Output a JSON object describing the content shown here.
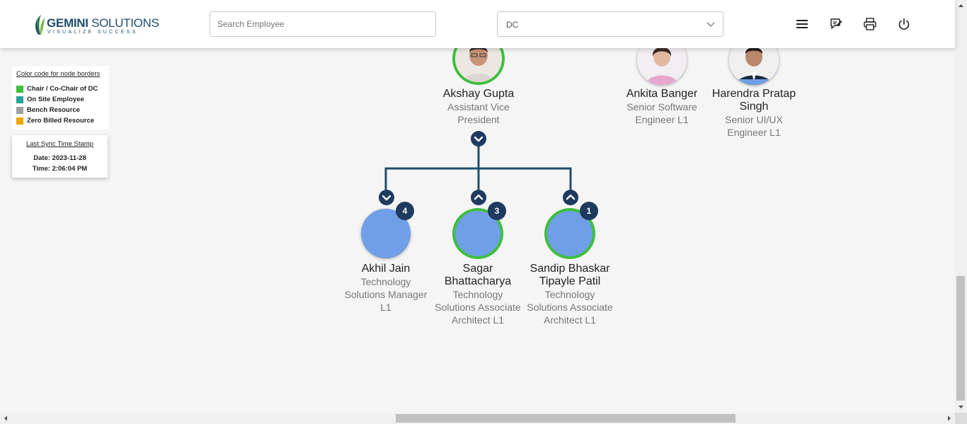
{
  "header": {
    "logo_main_bold": "GEMINI",
    "logo_main_rest": " SOLUTIONS",
    "logo_tagline": "VISUALIZE SUCCESS",
    "search_placeholder": "Search Employee",
    "dept_selected": "DC",
    "icons": [
      "menu-icon",
      "feedback-icon",
      "print-icon",
      "power-icon"
    ]
  },
  "legend": {
    "title": "Color code for node borders",
    "items": [
      {
        "label": "Chair / Co-Chair of DC",
        "color": "#3fbf3f"
      },
      {
        "label": "On Site Employee",
        "color": "#2aa198"
      },
      {
        "label": "Bench Resource",
        "color": "#a0a0a0"
      },
      {
        "label": "Zero Billed Resource",
        "color": "#f0a500"
      }
    ]
  },
  "sync": {
    "title": "Last Sync Time Stamp",
    "date": "Date: 2023-11-28",
    "time": "Time: 2:06:04 PM"
  },
  "org": {
    "root": {
      "name": "Akshay Gupta",
      "role": "Assistant Vice President",
      "border": "chair"
    },
    "peers": [
      {
        "name": "Ankita Banger",
        "role": "Senior Software Engineer L1"
      },
      {
        "name": "Harendra Pratap Singh",
        "role": "Senior UI/UX Engineer L1"
      }
    ],
    "children": [
      {
        "name": "Akhil Jain",
        "role": "Technology Solutions Manager L1",
        "count": "4",
        "border": "none"
      },
      {
        "name": "Sagar Bhattacharya",
        "role": "Technology Solutions Associate Architect L1",
        "count": "3",
        "border": "chair"
      },
      {
        "name": "Sandip Bhaskar Tipayle Patil",
        "role": "Technology Solutions Associate Architect L1",
        "count": "1",
        "border": "chair"
      }
    ]
  },
  "colors": {
    "accent": "#1e3a5f",
    "connector": "#1f4e6e",
    "chair_border": "#3fbf3f",
    "avatar_placeholder": "#6f9fe6"
  }
}
